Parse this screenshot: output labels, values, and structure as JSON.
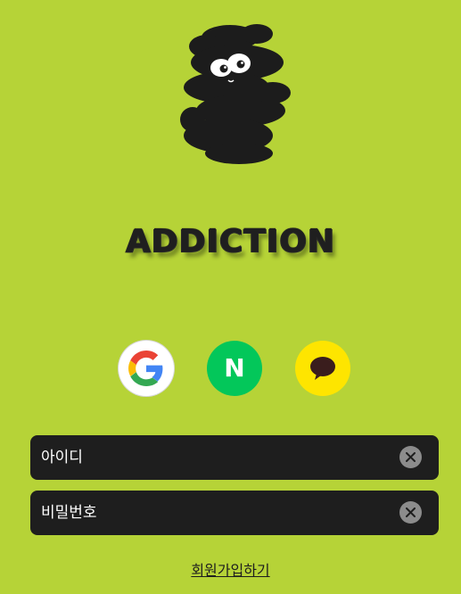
{
  "brand": {
    "wordmark": "ADDICTION"
  },
  "social_login": [
    {
      "provider": "Google",
      "icon": "google-icon"
    },
    {
      "provider": "Naver",
      "icon": "naver-icon",
      "glyph": "N"
    },
    {
      "provider": "Kakao",
      "icon": "kakao-chat-icon"
    }
  ],
  "form": {
    "id_field": {
      "placeholder": "아이디",
      "value": ""
    },
    "password_field": {
      "placeholder": "비밀번호",
      "value": ""
    }
  },
  "signup_link": {
    "label": "회원가입하기"
  },
  "colors": {
    "background": "#b6d337",
    "field_background": "#1e1e1e",
    "naver_green": "#03c75a",
    "kakao_yellow": "#fee500"
  }
}
